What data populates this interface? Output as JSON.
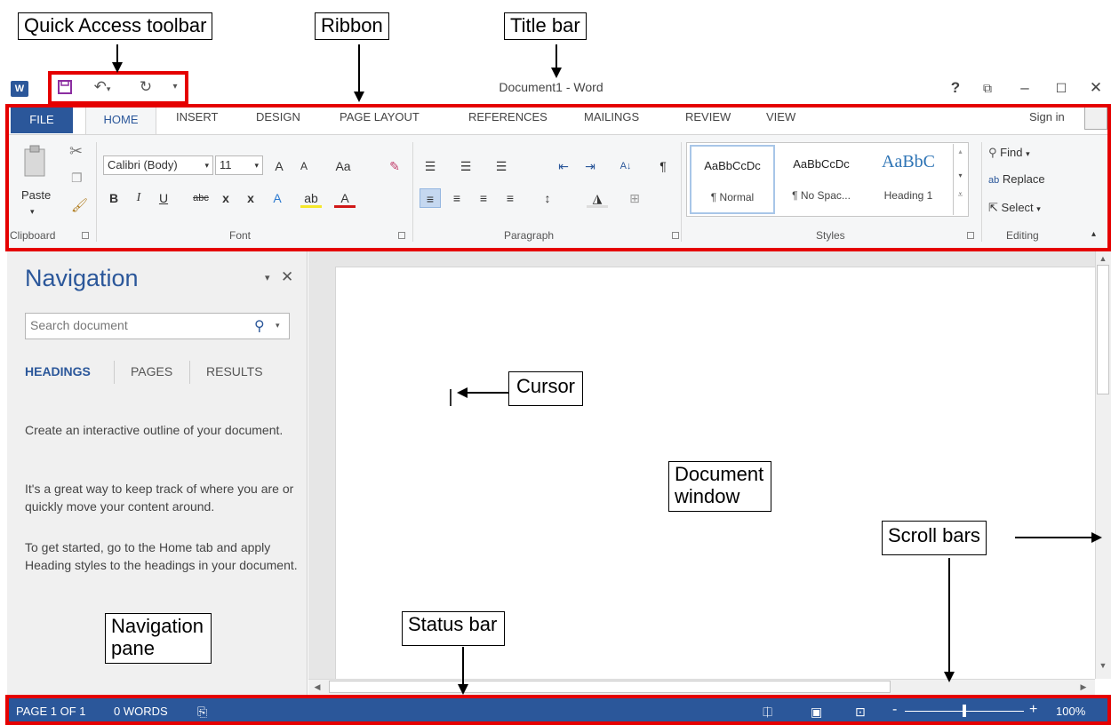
{
  "callouts": {
    "qat": "Quick Access toolbar",
    "ribbon": "Ribbon",
    "titlebar": "Title bar",
    "cursor": "Cursor",
    "document_line1": "Document",
    "document_line2": "window",
    "scrollbars": "Scroll bars",
    "navpane_line1": "Navigation",
    "navpane_line2": "pane",
    "statusbar": "Status bar"
  },
  "window": {
    "title": "Document1 - Word",
    "app_icon": "W",
    "controls": [
      "?",
      "⧉",
      "–",
      "☐",
      "✕"
    ]
  },
  "qat": {
    "icons": [
      "save-icon",
      "undo-icon",
      "redo-icon",
      "customize-icon"
    ]
  },
  "ribbon": {
    "tabs": [
      "FILE",
      "HOME",
      "INSERT",
      "DESIGN",
      "PAGE LAYOUT",
      "REFERENCES",
      "MAILINGS",
      "REVIEW",
      "VIEW"
    ],
    "sign_in": "Sign in",
    "clipboard": {
      "paste": "Paste",
      "label": "Clipboard"
    },
    "font": {
      "family": "Calibri (Body)",
      "size": "11",
      "grow": "A",
      "shrink": "A",
      "case": "Aa",
      "bold": "B",
      "italic": "I",
      "underline": "U",
      "strike": "abc",
      "subscript": "x",
      "superscript": "x",
      "color_letter": "A",
      "label": "Font"
    },
    "paragraph": {
      "label": "Paragraph",
      "sort": "A↓",
      "pilcrow": "¶"
    },
    "styles": {
      "items": [
        {
          "sample": "AaBbCcDc",
          "name": "¶ Normal"
        },
        {
          "sample": "AaBbCcDc",
          "name": "¶ No Spac..."
        },
        {
          "sample": "AaBbC",
          "name": "Heading 1"
        }
      ],
      "label": "Styles"
    },
    "editing": {
      "find": "Find",
      "replace": "Replace",
      "select": "Select",
      "label": "Editing"
    }
  },
  "navigation": {
    "title": "Navigation",
    "search_placeholder": "Search document",
    "tabs": [
      "HEADINGS",
      "PAGES",
      "RESULTS"
    ],
    "paragraphs": [
      "Create an interactive outline of your document.",
      "It's a great way to keep track of where you are or quickly move your content around.",
      "To get started, go to the Home tab and apply Heading styles to the headings in your document."
    ]
  },
  "statusbar": {
    "page": "PAGE 1 OF 1",
    "words": "0 WORDS",
    "zoom": "100%",
    "zoom_minus": "-",
    "zoom_plus": "+"
  },
  "colors": {
    "accent": "#2b579a",
    "highlight": "#e50000"
  }
}
